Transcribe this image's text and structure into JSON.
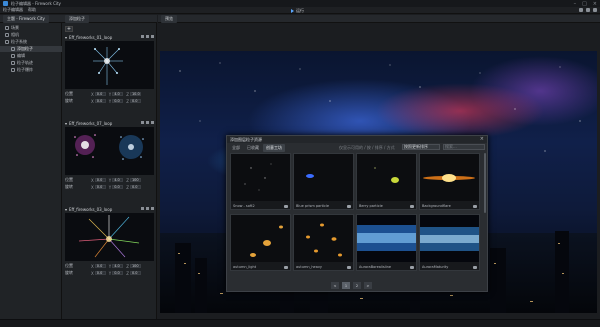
{
  "app": {
    "title": "粒子编辑器 - Firework City"
  },
  "menu": {
    "items": [
      "粒子编辑器",
      "帮助"
    ],
    "run_label": "运行"
  },
  "left_panel": {
    "tab_label": "主题 - Firework City",
    "items": [
      {
        "label": "场景"
      },
      {
        "label": "相机"
      },
      {
        "label": "粒子系统"
      },
      {
        "label": "添加粒子"
      },
      {
        "label": "编辑"
      },
      {
        "label": "粒子轨迹"
      },
      {
        "label": "粒子爆炸"
      }
    ]
  },
  "emitter_panel": {
    "tab_label": "添加粒子",
    "add_label": "+",
    "emitters": [
      {
        "name": "Eff_fireworks_01_loop",
        "pos_label": "位置",
        "rot_label": "旋转",
        "pos": {
          "x": "0.0",
          "y": "4.0",
          "z": "10.0"
        },
        "rot": {
          "x": "0.0",
          "y": "0.0",
          "z": "0.0"
        }
      },
      {
        "name": "Eff_fireworks_07_loop",
        "pos_label": "位置",
        "rot_label": "旋转",
        "pos": {
          "x": "0.0",
          "y": "4.0",
          "z": "100"
        },
        "rot": {
          "x": "0.0",
          "y": "0.0",
          "z": "0.0"
        }
      },
      {
        "name": "Eff_fireworks_03_loop",
        "pos_label": "位置",
        "rot_label": "旋转",
        "pos": {
          "x": "0.0",
          "y": "4.0",
          "z": "100"
        },
        "rot": {
          "x": "0.0",
          "y": "0.0",
          "z": "0.0"
        }
      }
    ]
  },
  "viewport": {
    "tab_label": "预览"
  },
  "dialog": {
    "title": "添加图层粒子资源",
    "close": "×",
    "tabs": [
      {
        "label": "全部"
      },
      {
        "label": "已收藏"
      },
      {
        "label": "创意工坊"
      }
    ],
    "sort_hint": "仅显示可用的 / 按 / 排序 / 方式",
    "sort_value": "按照更新排序",
    "search_placeholder": "搜索...",
    "cards": [
      {
        "label": "Snow - soft2"
      },
      {
        "label": "Blue prism particle"
      },
      {
        "label": "Berry particle"
      },
      {
        "label": "Backgroundflare"
      },
      {
        "label": "autumn_light"
      },
      {
        "label": "autumn_heavy"
      },
      {
        "label": "AuroraBorealisline"
      },
      {
        "label": "AuroraMaturity"
      }
    ],
    "pages": [
      "<",
      "1",
      "2",
      ">"
    ]
  }
}
